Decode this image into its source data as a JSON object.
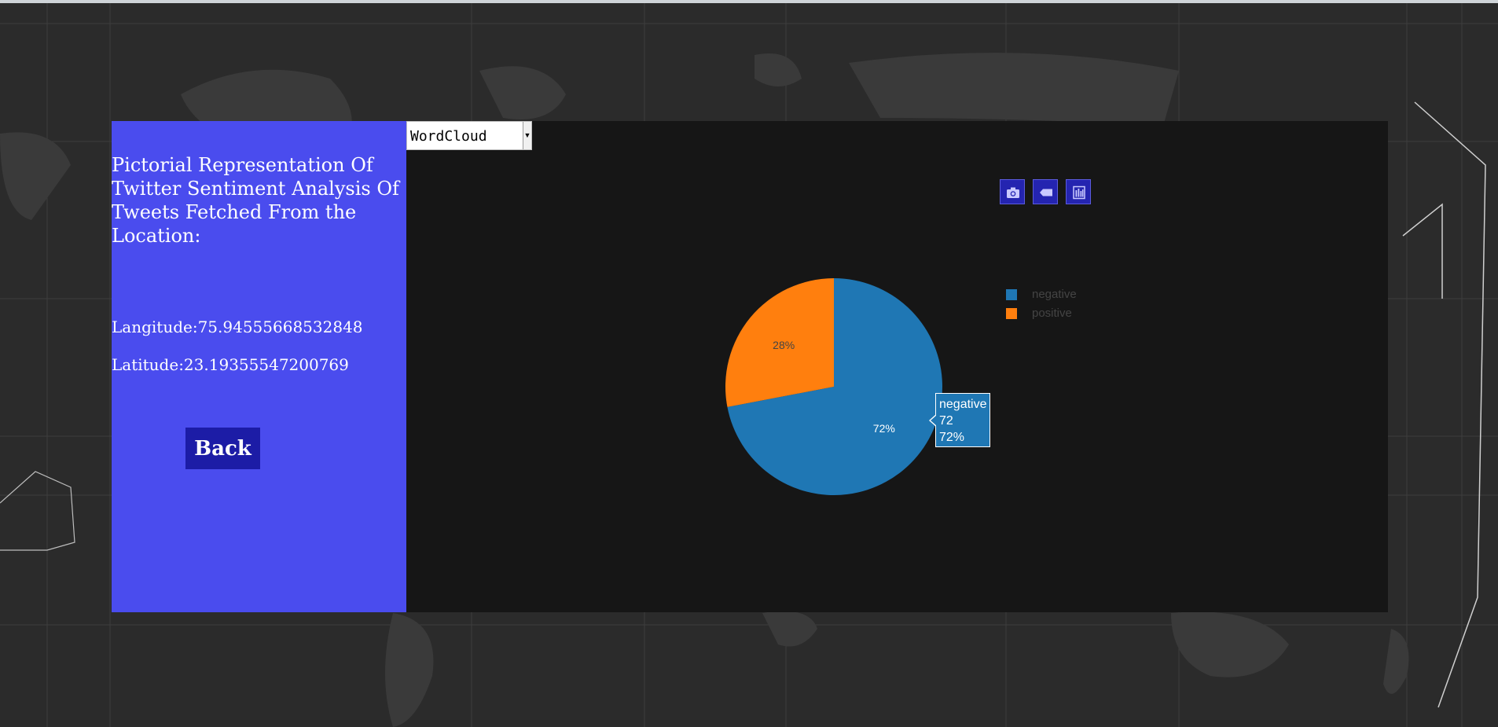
{
  "page": {
    "title": "Pictorial Representation Of Twitter Sentiment Analysis Of Tweets Fetched From the Location:",
    "longitude_label": "Langitude:75.94555668532848",
    "latitude_label": "Latitude:23.19355547200769",
    "back_label": "Back"
  },
  "viz_select": {
    "selected": "WordCloud"
  },
  "modebar": {
    "icons": [
      "camera-icon",
      "tag-icon",
      "bar-chart-icon"
    ]
  },
  "chart_data": {
    "type": "pie",
    "labels": [
      "negative",
      "positive"
    ],
    "values": [
      72,
      28
    ],
    "text": [
      "72%",
      "28%"
    ],
    "colors": [
      "#1f77b4",
      "#ff7f0e"
    ],
    "legend_position": "right"
  },
  "tooltip": {
    "label": "negative",
    "value": "72",
    "percent": "72%"
  },
  "colors": {
    "side_panel": "#4a4cee",
    "back_button": "#1c1ca6",
    "chart_bg": "#161616"
  }
}
